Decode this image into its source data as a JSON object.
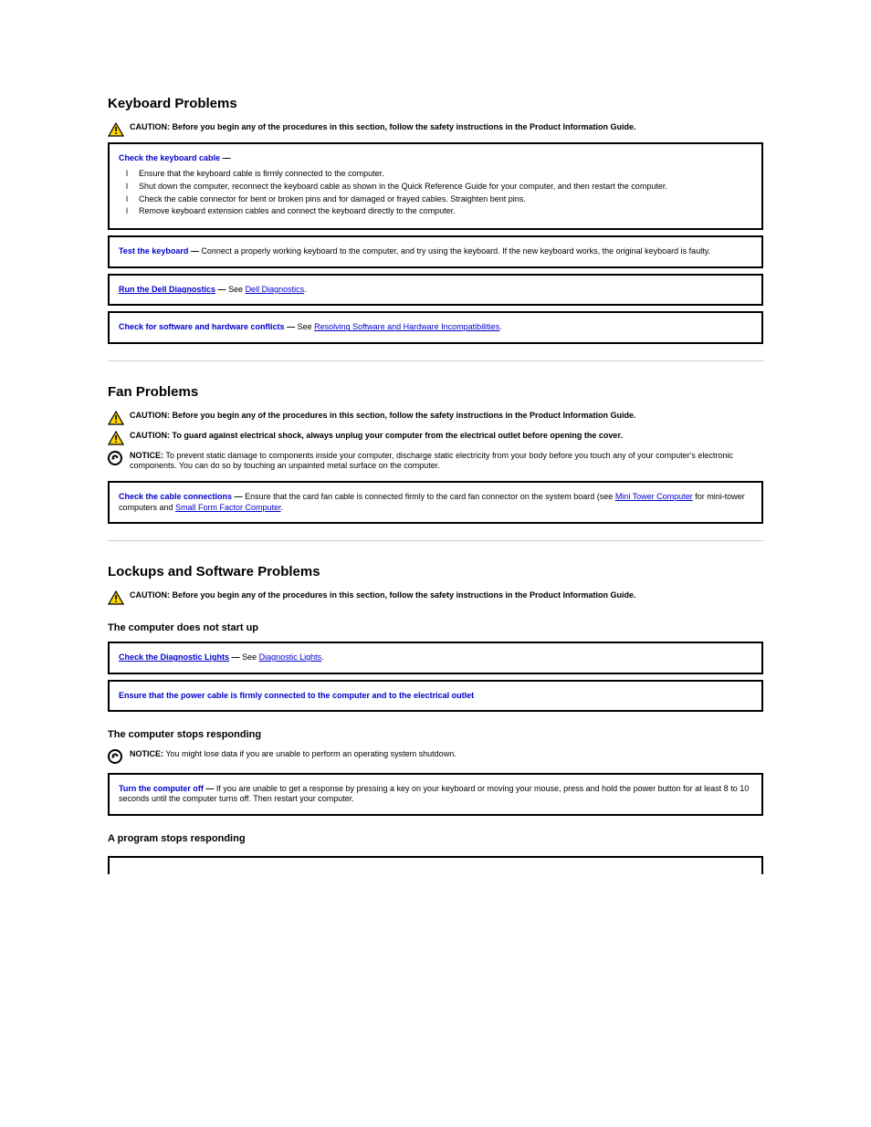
{
  "sections": {
    "keyboard": {
      "heading": "Keyboard Problems",
      "caution_label": "CAUTION: ",
      "caution_text": "Before you begin any of the procedures in this section, follow the safety instructions in the Product Information Guide.",
      "boxes": {
        "cable": {
          "lead": "Check the keyboard cable",
          "dash": "—",
          "items": [
            "Ensure that the keyboard cable is firmly connected to the computer.",
            "Shut down the computer, reconnect the keyboard cable as shown in the Quick Reference Guide for your computer, and then restart the computer.",
            "Check the cable connector for bent or broken pins and for damaged or frayed cables. Straighten bent pins.",
            "Remove keyboard extension cables and connect the keyboard directly to the computer."
          ]
        },
        "test_kb": {
          "lead": "Test the keyboard",
          "dash": "—",
          "body": " Connect a properly working keyboard to the computer, and try using the keyboard. If the new keyboard works, the original keyboard is faulty."
        },
        "run_diag": {
          "lead": "Run the Dell Diagnostics",
          "dash": "—",
          "see": " See ",
          "link": "Dell Diagnostics",
          "after": "."
        },
        "conflicts": {
          "lead": "Check for software and hardware conflicts",
          "dash": "—",
          "see": " See ",
          "link": "Resolving Software and Hardware Incompatibilities",
          "after": "."
        }
      }
    },
    "fan": {
      "heading": "Fan Problems",
      "caution_label": "CAUTION: ",
      "caution_text": "Before you begin any of the procedures in this section, follow the safety instructions in the Product Information Guide.",
      "caution2_label": "CAUTION: ",
      "caution2_text": "To guard against electrical shock, always unplug your computer from the electrical outlet before opening the cover.",
      "notice_label": "NOTICE:",
      "notice_text": " To prevent static damage to components inside your computer, discharge static electricity from your body before you touch any of your computer's electronic components. You can do so by touching an unpainted metal surface on the computer.",
      "box": {
        "lead": "Check the cable connections",
        "dash": "—",
        "body_pre": " Ensure that the card fan cable is connected firmly to the card fan connector on the system board (see ",
        "link1": "Mini Tower Computer",
        "body_mid": " for mini-tower computers and ",
        "link2": "Small Form Factor Computer",
        "body_post": "."
      }
    },
    "lockups": {
      "heading": "Lockups and Software Problems",
      "caution_label": "CAUTION: ",
      "caution_text": "Before you begin any of the procedures in this section, follow the safety instructions in the Product Information Guide.",
      "nostart": {
        "heading": "The computer does not start up",
        "lead": "Check the Diagnostic Lights",
        "dash": "—",
        "see": " See ",
        "link": "Diagnostic Lights",
        "after": "."
      },
      "power": {
        "lead": "Ensure that the power cable is firmly connected to the computer and to the electrical outlet"
      },
      "stops": {
        "heading": "The computer stops responding",
        "notice_label": "NOTICE:",
        "notice_text": " You might lose data if you are unable to perform an operating system shutdown.",
        "lead": "Turn the computer off",
        "dash": "—",
        "body": " If you are unable to get a response by pressing a key on your keyboard or moving your mouse, press and hold the power button for at least 8 to 10 seconds until the computer turns off. Then restart your computer."
      },
      "program_stops": {
        "heading": "A program stops responding"
      }
    }
  }
}
